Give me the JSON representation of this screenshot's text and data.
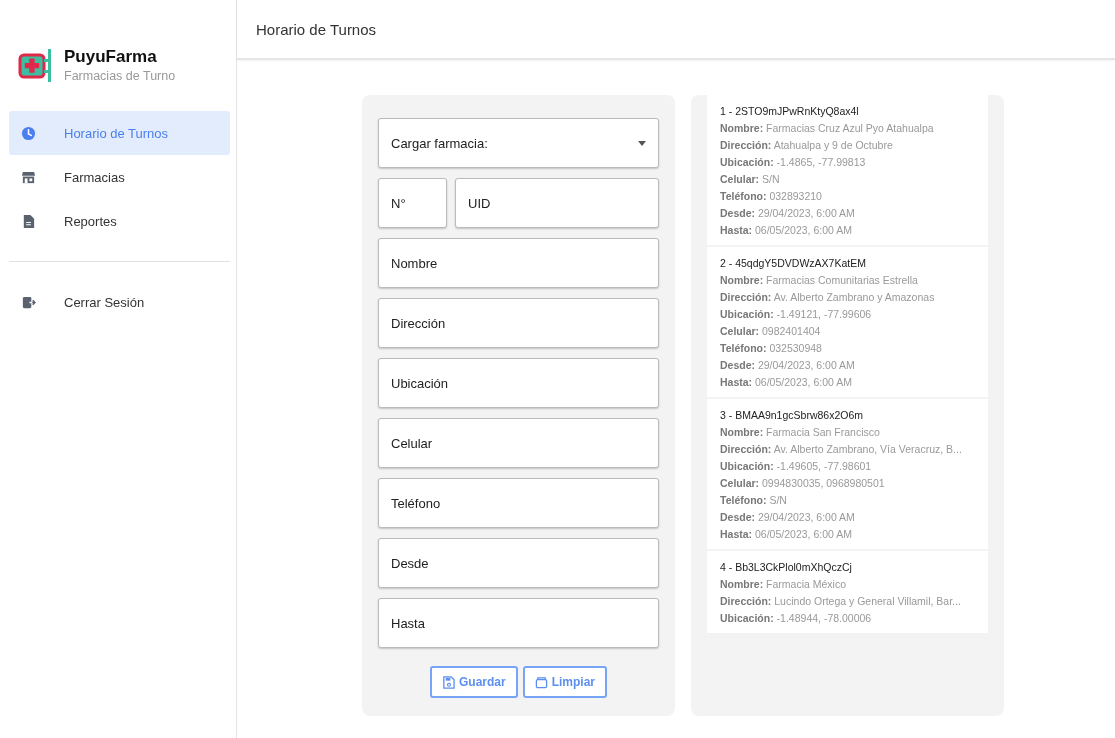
{
  "brand": {
    "name": "PuyuFarma",
    "subtitle": "Farmacias de Turno"
  },
  "nav": [
    {
      "kind": "clock",
      "label": "Horario de Turnos",
      "selected": true
    },
    {
      "kind": "store",
      "label": "Farmacias",
      "selected": false
    },
    {
      "kind": "file",
      "label": "Reportes",
      "selected": false
    }
  ],
  "logout": {
    "label": "Cerrar Sesión"
  },
  "header": {
    "title": "Horario de Turnos"
  },
  "form": {
    "rows": [
      [
        {
          "kind": "select",
          "label": "Cargar farmacia:"
        }
      ],
      [
        {
          "kind": "input",
          "placeholder": "N°"
        },
        {
          "kind": "input",
          "placeholder": "UID"
        }
      ],
      [
        {
          "kind": "input",
          "placeholder": "Nombre"
        }
      ],
      [
        {
          "kind": "input",
          "placeholder": "Dirección"
        }
      ],
      [
        {
          "kind": "input",
          "placeholder": "Ubicación"
        }
      ],
      [
        {
          "kind": "input",
          "placeholder": "Celular"
        }
      ],
      [
        {
          "kind": "input",
          "placeholder": "Teléfono"
        }
      ],
      [
        {
          "kind": "input",
          "placeholder": "Desde"
        }
      ],
      [
        {
          "kind": "input",
          "placeholder": "Hasta"
        }
      ]
    ],
    "buttons": [
      {
        "kind": "save",
        "label": "Guardar"
      },
      {
        "kind": "clear",
        "label": "Limpiar"
      }
    ]
  },
  "records": [
    {
      "title": "1 - 2STO9mJPwRnKtyQ8ax4l",
      "lines": [
        "**Nombre:** Farmacias Cruz Azul Pyo Atahualpa",
        "**Dirección:** Atahualpa y 9 de Octubre",
        "**Ubicación:** -1.4865, -77.99813",
        "**Celular:** S/N",
        "**Teléfono:** 032893210",
        "**Desde:** 29/04/2023, 6:00 AM",
        "**Hasta:** 06/05/2023, 6:00 AM"
      ]
    },
    {
      "title": "2 - 45qdgY5DVDWzAX7KatEM",
      "lines": [
        "**Nombre:** Farmacias Comunitarias Estrella",
        "**Dirección:** Av. Alberto Zambrano y Amazonas",
        "**Ubicación:** -1.49121, -77.99606",
        "**Celular:** 0982401404",
        "**Teléfono:** 032530948",
        "**Desde:** 29/04/2023, 6:00 AM",
        "**Hasta:** 06/05/2023, 6:00 AM"
      ]
    },
    {
      "title": "3 - BMAA9n1gcSbrw86x2O6m",
      "lines": [
        "**Nombre:** Farmacia San Francisco",
        "**Dirección:** Av. Alberto Zambrano, Vía Veracruz, B...",
        "**Ubicación:** -1.49605, -77.98601",
        "**Celular:** 0994830035, 0968980501",
        "**Teléfono:** S/N",
        "**Desde:** 29/04/2023, 6:00 AM",
        "**Hasta:** 06/05/2023, 6:00 AM"
      ]
    },
    {
      "title": "4 - Bb3L3CkPlol0mXhQczCj",
      "lines": [
        "**Nombre:** Farmacia México",
        "**Dirección:** Lucindo Ortega y General Villamil, Bar...",
        "**Ubicación:** -1.48944, -78.00006"
      ]
    }
  ]
}
